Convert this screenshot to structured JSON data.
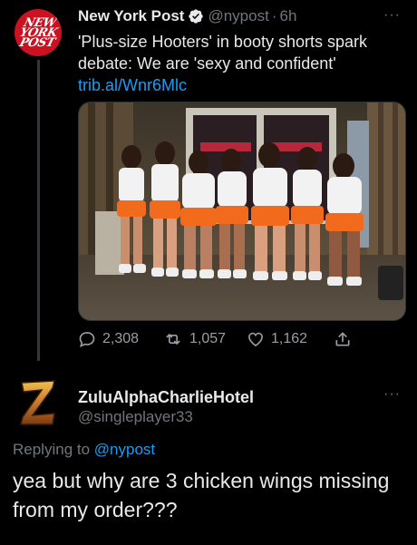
{
  "tweet": {
    "avatar_text": [
      "NEW",
      "YORK",
      "POST"
    ],
    "author_name": "New York Post",
    "author_handle": "@nypost",
    "separator": "·",
    "time": "6h",
    "more": "···",
    "text": "'Plus-size Hooters' in booty shorts spark debate: We are 'sexy and confident'",
    "link": "trib.al/Wnr6Mlc",
    "media_icon": "photo-of-hooters-waitresses",
    "stats": {
      "replies": "2,308",
      "retweets": "1,057",
      "likes": "1,162"
    }
  },
  "reply": {
    "author_name": "ZuluAlphaCharlieHotel",
    "author_handle": "@singleplayer33",
    "more": "···",
    "replying_prefix": "Replying to",
    "replying_handle": "@nypost",
    "text": "yea but why are 3 chicken wings missing from my order???"
  },
  "colors": {
    "background": "#000000",
    "text": "#e7e9ea",
    "muted": "#71767b",
    "link": "#1d9bf0",
    "brand_red": "#ca1220"
  }
}
